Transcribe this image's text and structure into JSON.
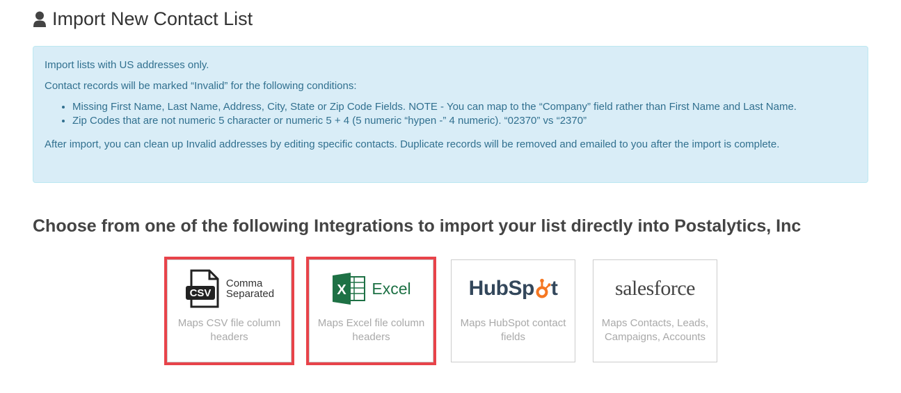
{
  "header": {
    "title": "Import New Contact List",
    "icon": "user-icon"
  },
  "notice": {
    "line1": "Import lists with US addresses only.",
    "line2": "Contact records will be marked “Invalid” for the following conditions:",
    "bullets": [
      "Missing First Name, Last Name, Address, City, State or Zip Code Fields. NOTE - You can map to the “Company” field rather than First Name and Last Name.",
      "Zip Codes that are not numeric 5 character or numeric 5 + 4 (5 numeric “hypen -” 4 numeric). “02370” vs “2370”"
    ],
    "line3": "After import, you can clean up Invalid addresses by editing specific contacts. Duplicate records will be removed and emailed to you after the import is complete."
  },
  "integrations": {
    "heading": "Choose from one of the following Integrations to import your list directly into Postalytics, Inc",
    "cards": [
      {
        "logo_icon": "csv-file-icon",
        "logo_text_1": "Comma",
        "logo_text_2": "Separated",
        "logo_badge": "CSV",
        "description": "Maps CSV file column headers",
        "highlighted": true
      },
      {
        "logo_icon": "excel-icon",
        "logo_text": "Excel",
        "logo_badge": "X",
        "description": "Maps Excel file column headers",
        "highlighted": true
      },
      {
        "logo_icon": "hubspot-logo",
        "logo_text_1": "HubSp",
        "logo_text_2": "t",
        "description": "Maps HubSpot contact fields",
        "highlighted": false
      },
      {
        "logo_icon": "salesforce-logo",
        "logo_text": "salesforce",
        "description": "Maps Contacts, Leads, Campaigns, Accounts",
        "highlighted": false
      }
    ]
  },
  "colors": {
    "alert_bg": "#d9edf7",
    "alert_text": "#31708f",
    "highlight_border": "#e8434a",
    "excel_green": "#1e7145",
    "hubspot_orange": "#f57722"
  }
}
